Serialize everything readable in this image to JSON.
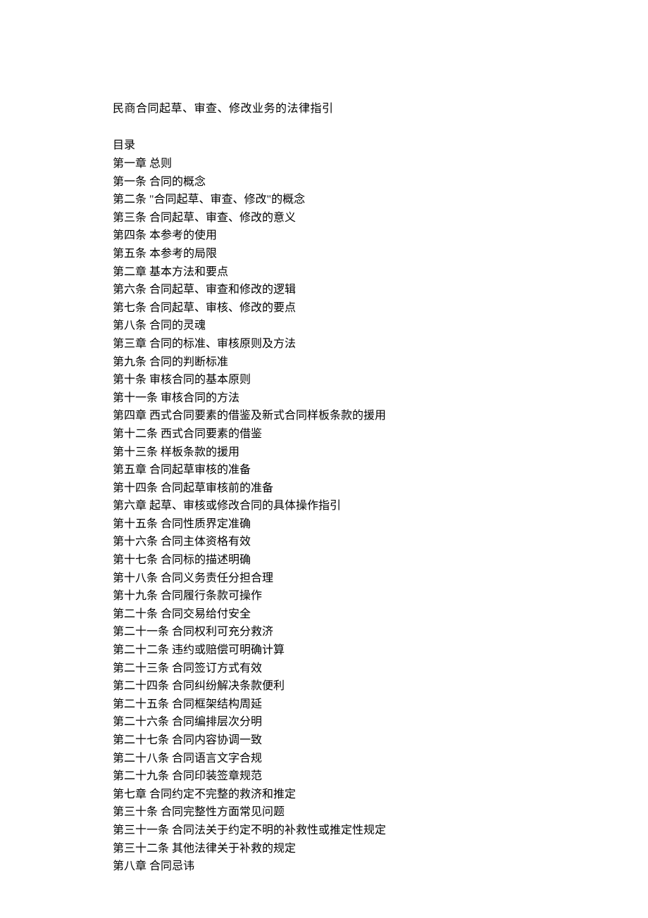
{
  "title": "民商合同起草、审查、修改业务的法律指引",
  "toc_label": "目录",
  "lines": [
    "第一章  总则",
    "第一条  合同的概念",
    "第二条  \"合同起草、审查、修改\"的概念",
    "第三条  合同起草、审查、修改的意义",
    "第四条  本参考的使用",
    "第五条  本参考的局限",
    "第二章  基本方法和要点",
    "第六条  合同起草、审查和修改的逻辑",
    "第七条  合同起草、审核、修改的要点",
    "第八条  合同的灵魂",
    "第三章  合同的标准、审核原则及方法",
    "第九条  合同的判断标准",
    "第十条  审核合同的基本原则",
    "第十一条  审核合同的方法",
    "第四章  西式合同要素的借鉴及新式合同样板条款的援用",
    "第十二条  西式合同要素的借鉴",
    "第十三条  样板条款的援用",
    "第五章  合同起草审核的准备",
    "第十四条  合同起草审核前的准备",
    "第六章  起草、审核或修改合同的具体操作指引",
    "第十五条  合同性质界定准确",
    "第十六条  合同主体资格有效",
    "第十七条  合同标的描述明确",
    "第十八条  合同义务责任分担合理",
    "第十九条  合同履行条款可操作",
    "第二十条  合同交易给付安全",
    "第二十一条  合同权利可充分救济",
    "第二十二条  违约或赔偿可明确计算",
    "第二十三条  合同签订方式有效",
    "第二十四条  合同纠纷解决条款便利",
    "第二十五条  合同框架结构周延",
    "第二十六条  合同编排层次分明",
    "第二十七条  合同内容协调一致",
    "第二十八条  合同语言文字合规",
    "第二十九条  合同印装签章规范",
    "第七章  合同约定不完整的救济和推定",
    "第三十条  合同完整性方面常见问题",
    "第三十一条  合同法关于约定不明的补救性或推定性规定",
    "第三十二条  其他法律关于补救的规定",
    "第八章  合同忌讳"
  ]
}
